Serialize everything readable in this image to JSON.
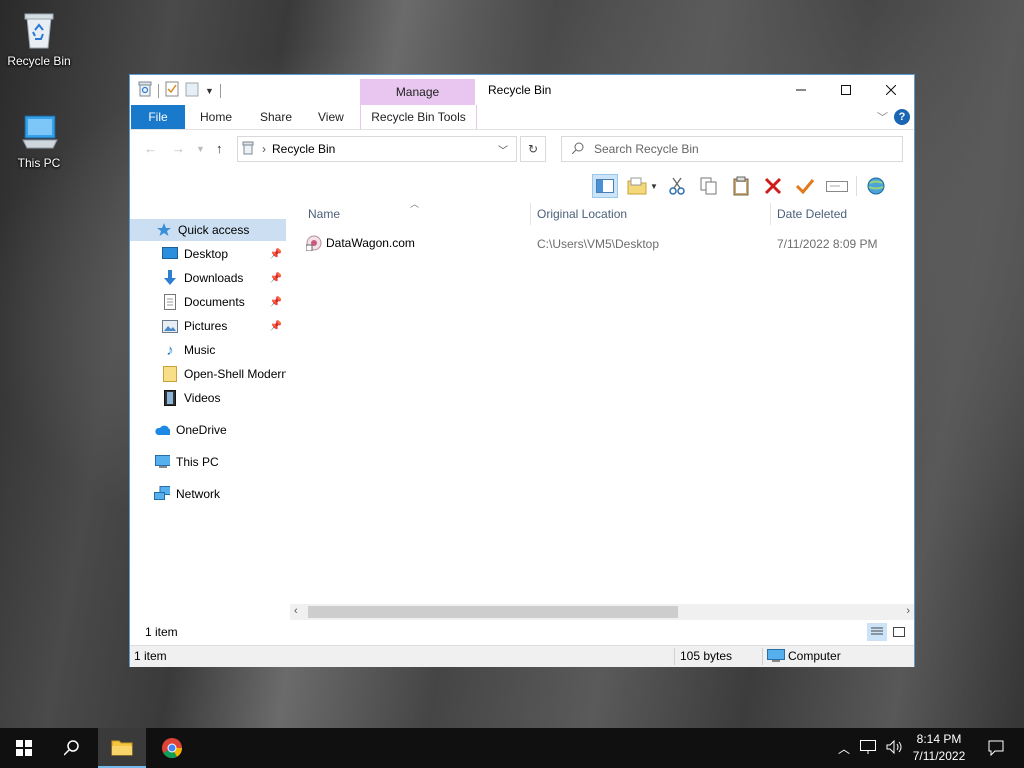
{
  "desktop": {
    "icons": [
      {
        "label": "Recycle Bin"
      },
      {
        "label": "This PC"
      }
    ]
  },
  "window": {
    "title": "Recycle Bin",
    "manage_tab": "Manage",
    "ribbon_tabs": {
      "file": "File",
      "home": "Home",
      "share": "Share",
      "view": "View",
      "tools": "Recycle Bin Tools"
    },
    "help_label": "?",
    "address": {
      "path": "Recycle Bin"
    },
    "search": {
      "placeholder": "Search Recycle Bin"
    },
    "sidebar": {
      "items": [
        {
          "label": "Quick access"
        },
        {
          "label": "Desktop"
        },
        {
          "label": "Downloads"
        },
        {
          "label": "Documents"
        },
        {
          "label": "Pictures"
        },
        {
          "label": "Music"
        },
        {
          "label": "Open-Shell Modern"
        },
        {
          "label": "Videos"
        },
        {
          "label": "OneDrive"
        },
        {
          "label": "This PC"
        },
        {
          "label": "Network"
        }
      ]
    },
    "columns": {
      "name": "Name",
      "original_location": "Original Location",
      "date_deleted": "Date Deleted"
    },
    "files": [
      {
        "name": "DataWagon.com",
        "original_location": "C:\\Users\\VM5\\Desktop",
        "date_deleted": "7/11/2022 8:09 PM"
      }
    ],
    "item_count": "1 item",
    "status": {
      "items": "1 item",
      "size": "105 bytes",
      "location": "Computer"
    }
  },
  "taskbar": {
    "clock_time": "8:14 PM",
    "clock_date": "7/11/2022"
  }
}
